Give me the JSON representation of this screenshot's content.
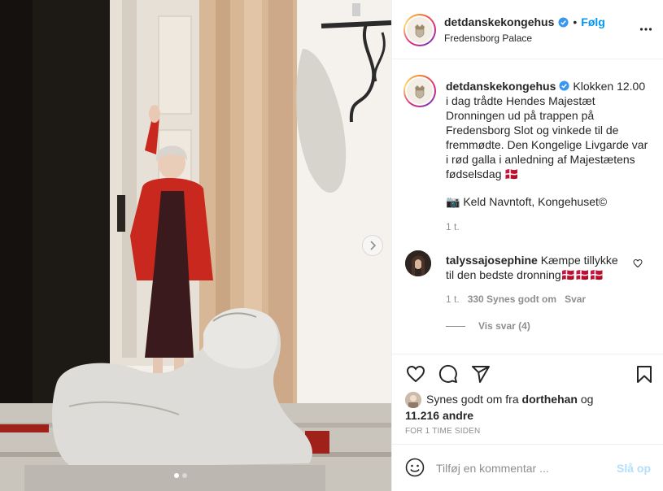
{
  "post": {
    "author": "detdanskekongehus",
    "follow_label": "Følg",
    "separator": "•",
    "location": "Fredensborg Palace",
    "caption": "Klokken 12.00 i dag trådte Hendes Majestæt Dronningen ud på trappen på Fredensborg Slot og vinkede til de fremmødte. Den Kongelige Livgarde var i rød galla i anledning af Majestætens fødselsdag 🇩🇰",
    "credit": "📷 Keld Navntoft, Kongehuset©",
    "caption_time": "1 t.",
    "icons": [
      "crest-avatar",
      "verified-badge",
      "more-options-icon",
      "next-arrow-icon"
    ]
  },
  "comment": {
    "username": "talyssajosephine",
    "text": "Kæmpe tillykke til den bedste dronning🇩🇰🇩🇰🇩🇰",
    "time": "1 t.",
    "likes": "330 Synes godt om",
    "reply": "Svar",
    "view_replies": "Vis svar (4)"
  },
  "actions": {
    "icons": [
      "heart-icon",
      "comment-icon",
      "share-icon",
      "bookmark-icon"
    ]
  },
  "likes": {
    "prefix": "Synes godt om fra",
    "user": "dorthehan",
    "conjunction": "og",
    "others": "11.216 andre"
  },
  "timestamp": "FOR 1 TIME SIDEN",
  "add_comment": {
    "placeholder": "Tilføj en kommentar ...",
    "post_label": "Slå op"
  },
  "colors": {
    "link_blue": "#0095f6",
    "post_disabled": "#b2dffc",
    "muted": "#8e8e8e",
    "jacket_red": "#c8281e"
  },
  "carousel": {
    "slides": 2,
    "active": 1
  }
}
